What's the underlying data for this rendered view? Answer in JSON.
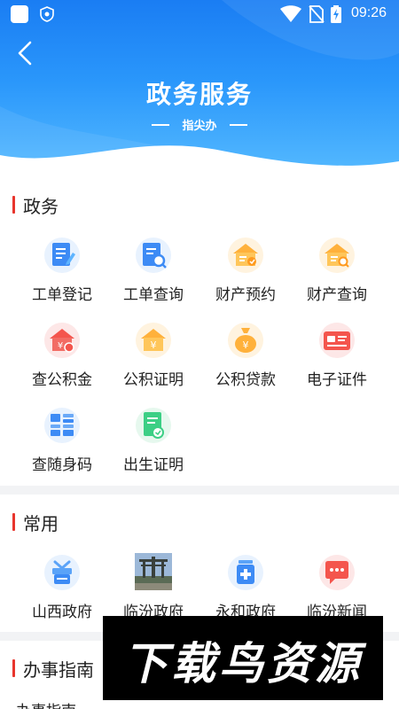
{
  "status_bar": {
    "time": "09:26"
  },
  "header": {
    "title": "政务服务",
    "subtitle": "指尖办"
  },
  "sections": [
    {
      "title": "政务",
      "items": [
        {
          "label": "工单登记",
          "icon": "form-edit-icon"
        },
        {
          "label": "工单查询",
          "icon": "document-search-icon"
        },
        {
          "label": "财产预约",
          "icon": "house-appointment-icon"
        },
        {
          "label": "财产查询",
          "icon": "house-search-icon"
        },
        {
          "label": "查公积金",
          "icon": "fund-house-icon"
        },
        {
          "label": "公积证明",
          "icon": "fund-certificate-icon"
        },
        {
          "label": "公积贷款",
          "icon": "money-bag-icon"
        },
        {
          "label": "电子证件",
          "icon": "id-card-icon"
        },
        {
          "label": "查随身码",
          "icon": "qr-code-icon"
        },
        {
          "label": "出生证明",
          "icon": "birth-certificate-icon"
        }
      ]
    },
    {
      "title": "常用",
      "items": [
        {
          "label": "山西政府",
          "icon": "gift-icon"
        },
        {
          "label": "临汾政府",
          "icon": "photo-thumbnail"
        },
        {
          "label": "永和政府",
          "icon": "medicine-jar-icon"
        },
        {
          "label": "临汾新闻",
          "icon": "chat-bubble-icon"
        }
      ]
    },
    {
      "title": "办事指南",
      "items": [
        {
          "label": "办事指南"
        }
      ]
    }
  ],
  "watermark": {
    "text": "下载鸟资源"
  },
  "colors": {
    "header_blue": "#1a7df3",
    "accent_red": "#e8352d"
  }
}
